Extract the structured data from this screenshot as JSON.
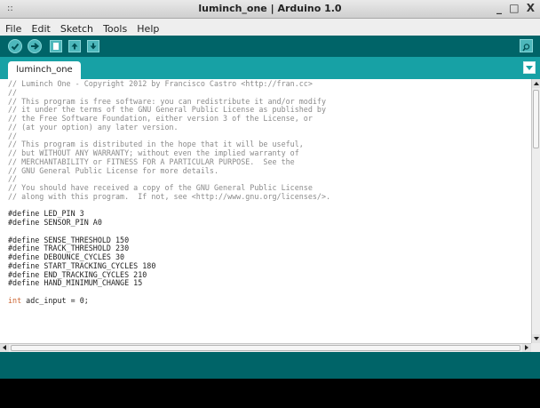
{
  "window": {
    "title": "luminch_one | Arduino 1.0",
    "grip": "::",
    "controls": "_ □ X"
  },
  "menu": [
    "File",
    "Edit",
    "Sketch",
    "Tools",
    "Help"
  ],
  "toolbar": {
    "buttons": [
      "verify-icon",
      "upload-icon",
      "new-icon",
      "open-icon",
      "save-icon"
    ],
    "serial_monitor": "serial-monitor-icon"
  },
  "tabs": [
    {
      "label": "luminch_one"
    }
  ],
  "editor": {
    "lines": [
      "// Luminch One - Copyright 2012 by Francisco Castro <http://fran.cc>",
      "//",
      "// This program is free software: you can redistribute it and/or modify",
      "// it under the terms of the GNU General Public License as published by",
      "// the Free Software Foundation, either version 3 of the License, or",
      "// (at your option) any later version.",
      "//",
      "// This program is distributed in the hope that it will be useful,",
      "// but WITHOUT ANY WARRANTY; without even the implied warranty of",
      "// MERCHANTABILITY or FITNESS FOR A PARTICULAR PURPOSE.  See the",
      "// GNU General Public License for more details.",
      "//",
      "// You should have received a copy of the GNU General Public License",
      "// along with this program.  If not, see <http://www.gnu.org/licenses/>.",
      "",
      "#define LED_PIN 3",
      "#define SENSOR_PIN A0",
      "",
      "#define SENSE_THRESHOLD 150",
      "#define TRACK_THRESHOLD 230",
      "#define DEBOUNCE_CYCLES 30",
      "#define START_TRACKING_CYCLES 180",
      "#define END_TRACKING_CYCLES 210",
      "#define HAND_MINIMUM_CHANGE 15",
      "",
      "int adc_input = 0;"
    ]
  },
  "colors": {
    "toolbar": "#006468",
    "tabbar": "#17a1a5",
    "button": "#4db7bb",
    "comment": "#8b8b8b",
    "keyword": "#cc6633"
  }
}
